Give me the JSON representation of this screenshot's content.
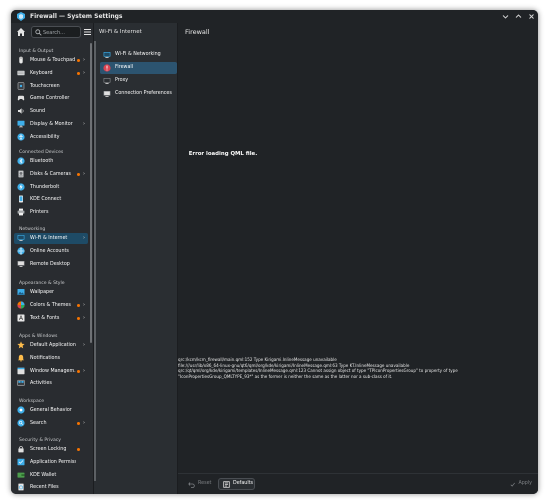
{
  "window": {
    "title": "Firewall — System Settings"
  },
  "sidebar": {
    "search_placeholder": "Search...",
    "sections": [
      {
        "title": "Input & Output",
        "items": [
          {
            "label": "Mouse & Touchpad",
            "icon": "mouse-icon",
            "dot": true,
            "arrow": true
          },
          {
            "label": "Keyboard",
            "icon": "keyboard-icon",
            "dot": true,
            "arrow": true
          },
          {
            "label": "Touchscreen",
            "icon": "touchscreen-icon",
            "dot": false,
            "arrow": false
          },
          {
            "label": "Game Controller",
            "icon": "gamepad-icon",
            "dot": false,
            "arrow": false
          },
          {
            "label": "Sound",
            "icon": "speaker-icon",
            "dot": false,
            "arrow": false
          },
          {
            "label": "Display & Monitor",
            "icon": "monitor-icon",
            "dot": false,
            "arrow": true
          },
          {
            "label": "Accessibility",
            "icon": "accessibility-icon",
            "dot": false,
            "arrow": false
          }
        ]
      },
      {
        "title": "Connected Devices",
        "items": [
          {
            "label": "Bluetooth",
            "icon": "bluetooth-icon",
            "dot": false,
            "arrow": false
          },
          {
            "label": "Disks & Cameras",
            "icon": "disks-icon",
            "dot": true,
            "arrow": true
          },
          {
            "label": "Thunderbolt",
            "icon": "thunderbolt-icon",
            "dot": false,
            "arrow": false
          },
          {
            "label": "KDE Connect",
            "icon": "kde-connect-icon",
            "dot": false,
            "arrow": false
          },
          {
            "label": "Printers",
            "icon": "printer-icon",
            "dot": false,
            "arrow": false
          }
        ]
      },
      {
        "title": "Networking",
        "items": [
          {
            "label": "Wi-Fi & Internet",
            "icon": "network-icon",
            "dot": false,
            "arrow": true,
            "selected": true
          },
          {
            "label": "Online Accounts",
            "icon": "online-accounts-icon",
            "dot": false,
            "arrow": false
          },
          {
            "label": "Remote Desktop",
            "icon": "remote-desktop-icon",
            "dot": false,
            "arrow": false
          }
        ]
      },
      {
        "title": "Appearance & Style",
        "items": [
          {
            "label": "Wallpaper",
            "icon": "wallpaper-icon",
            "dot": false,
            "arrow": false
          },
          {
            "label": "Colors & Themes",
            "icon": "colors-icon",
            "dot": true,
            "arrow": true
          },
          {
            "label": "Text & Fonts",
            "icon": "fonts-icon",
            "dot": true,
            "arrow": true
          }
        ]
      },
      {
        "title": "Apps & Windows",
        "items": [
          {
            "label": "Default Applications",
            "icon": "default-apps-icon",
            "dot": false,
            "arrow": true
          },
          {
            "label": "Notifications",
            "icon": "bell-icon",
            "dot": false,
            "arrow": false
          },
          {
            "label": "Window Managem...",
            "icon": "window-icon",
            "dot": true,
            "arrow": true
          },
          {
            "label": "Activities",
            "icon": "activities-icon",
            "dot": false,
            "arrow": false
          }
        ]
      },
      {
        "title": "Workspace",
        "items": [
          {
            "label": "General Behavior",
            "icon": "general-behavior-icon",
            "dot": false,
            "arrow": false
          },
          {
            "label": "Search",
            "icon": "search-icon",
            "dot": true,
            "arrow": true
          }
        ]
      },
      {
        "title": "Security & Privacy",
        "items": [
          {
            "label": "Screen Locking",
            "icon": "lock-icon",
            "dot": true,
            "arrow": false
          },
          {
            "label": "Application Permissi...",
            "icon": "permissions-icon",
            "dot": false,
            "arrow": false
          },
          {
            "label": "KDE Wallet",
            "icon": "wallet-icon",
            "dot": false,
            "arrow": false
          },
          {
            "label": "Recent Files",
            "icon": "recent-files-icon",
            "dot": false,
            "arrow": false
          }
        ]
      }
    ]
  },
  "subpanel": {
    "title": "Wi-Fi & Internet",
    "items": [
      {
        "label": "Wi-Fi & Networking",
        "icon": "network-icon"
      },
      {
        "label": "Firewall",
        "icon": "firewall-icon",
        "selected": true
      },
      {
        "label": "Proxy",
        "icon": "proxy-icon"
      },
      {
        "label": "Connection Preferences",
        "icon": "connection-preferences-icon"
      }
    ]
  },
  "main": {
    "title": "Firewall",
    "error_title": "Error loading QML file.",
    "error_lines": [
      "qrc:/kcm/kcm_firewall/main.qml:152 Type Kirigami.InlineMessage unavailable",
      "file:///usr/lib/x86_64-linux-gnu/qt6/qml/org/kde/kirigami/InlineMessage.qml:63 Type KT.InlineMessage unavailable",
      "qrc:/qt/qml/org/kde/kirigami/templates/InlineMessage.qml:123 Cannot assign object of type \"TPIconPropertiesGroup\" to property of type",
      "\"IconPropertiesGroup_QMLTYPE_93*\" as the former is neither the same as the latter nor a sub-class of it."
    ]
  },
  "footer": {
    "reset": "Reset",
    "defaults": "Defaults",
    "apply": "Apply"
  },
  "colors": {
    "accent": "#3daee9",
    "selected": "#1e4b66",
    "dot": "#f67400"
  }
}
